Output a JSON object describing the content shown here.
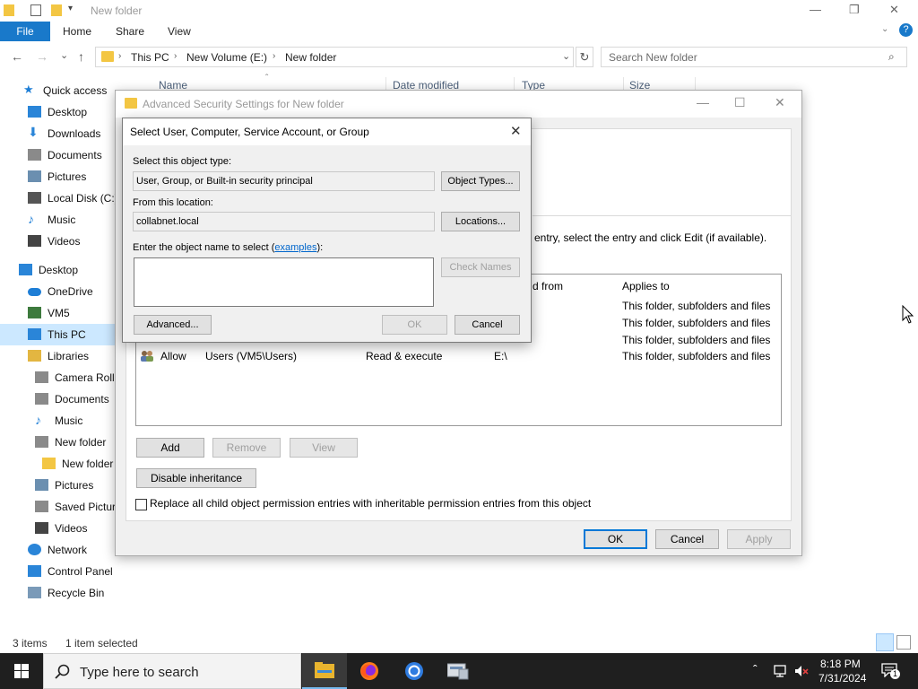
{
  "explorer": {
    "window_title": "New folder",
    "window_controls": {
      "minimize": "—",
      "maximize": "❐",
      "close": "✕"
    },
    "ribbon": {
      "file": "File",
      "home": "Home",
      "share": "Share",
      "view": "View",
      "expand": "⌄",
      "help": "?"
    },
    "nav_buttons": {
      "back": "←",
      "forward": "→",
      "recent": "⌄",
      "up": "↑"
    },
    "address": {
      "crumbs": [
        "This PC",
        "New Volume (E:)",
        "New folder"
      ],
      "sep": "›",
      "dropdown": "⌄",
      "refresh": "↻"
    },
    "search": {
      "placeholder": "Search New folder",
      "icon": "⌕"
    },
    "columns": [
      "Name",
      "Date modified",
      "Type",
      "Size"
    ],
    "sort_glyph": "ˆ",
    "sidebar": [
      {
        "label": "Quick access",
        "icon": "star-icon",
        "color": "#1e7ed6"
      },
      {
        "label": "Desktop",
        "icon": "desktop-icon",
        "color": "#2a85d8"
      },
      {
        "label": "Downloads",
        "icon": "downloads-icon",
        "color": "#2a85d8"
      },
      {
        "label": "Documents",
        "icon": "documents-icon",
        "color": "#8a8a8a"
      },
      {
        "label": "Pictures",
        "icon": "pictures-icon",
        "color": "#6b8fb0"
      },
      {
        "label": "Local Disk (C:)",
        "icon": "disk-icon",
        "color": "#555555"
      },
      {
        "label": "Music",
        "icon": "music-icon",
        "color": "#1e7ed6"
      },
      {
        "label": "Videos",
        "icon": "videos-icon",
        "color": "#444444"
      },
      {
        "label": "Desktop",
        "icon": "desktop-icon",
        "color": "#2a85d8"
      },
      {
        "label": "OneDrive",
        "icon": "onedrive-icon",
        "color": "#1e7ed6"
      },
      {
        "label": "VM5",
        "icon": "user-icon",
        "color": "#3d7a3d"
      },
      {
        "label": "This PC",
        "icon": "pc-icon",
        "color": "#2a85d8"
      },
      {
        "label": "Libraries",
        "icon": "libraries-icon",
        "color": "#e3b641"
      },
      {
        "label": "Camera Roll",
        "icon": "library-folder-icon",
        "color": "#8a8a8a"
      },
      {
        "label": "Documents",
        "icon": "documents-icon",
        "color": "#8a8a8a"
      },
      {
        "label": "Music",
        "icon": "music-icon",
        "color": "#1e7ed6"
      },
      {
        "label": "New folder",
        "icon": "library-folder-icon",
        "color": "#8a8a8a"
      },
      {
        "label": "New folder",
        "icon": "folder-icon",
        "color": "#f3c643"
      },
      {
        "label": "Pictures",
        "icon": "pictures-icon",
        "color": "#6b8fb0"
      },
      {
        "label": "Saved Pictures",
        "icon": "pictures-icon",
        "color": "#8a8a8a"
      },
      {
        "label": "Videos",
        "icon": "videos-icon",
        "color": "#444444"
      },
      {
        "label": "Network",
        "icon": "network-icon",
        "color": "#2a85d8"
      },
      {
        "label": "Control Panel",
        "icon": "control-panel-icon",
        "color": "#2a85d8"
      },
      {
        "label": "Recycle Bin",
        "icon": "recycle-bin-icon",
        "color": "#7a9ab8"
      }
    ],
    "status": {
      "items": "3 items",
      "selected": "1 item selected"
    }
  },
  "advanced_dialog": {
    "title": "Advanced Security Settings for New folder",
    "controls": {
      "minimize": "—",
      "maximize": "☐",
      "close": "✕"
    },
    "instruction": "entry, select the entry and click Edit (if available).",
    "columns": {
      "inherited_from": "d from",
      "applies_to": "Applies to"
    },
    "applies_rows": [
      "This folder, subfolders and files",
      "This folder, subfolders and files",
      "This folder, subfolders and files"
    ],
    "entry": {
      "type": "Allow",
      "principal": "Users (VM5\\Users)",
      "access": "Read & execute",
      "inherited_from": "E:\\",
      "applies_to": "This folder, subfolders and files"
    },
    "buttons": {
      "add": "Add",
      "remove": "Remove",
      "view": "View",
      "disable_inheritance": "Disable inheritance",
      "ok": "OK",
      "cancel": "Cancel",
      "apply": "Apply"
    },
    "replace_label": "Replace all child object permission entries with inheritable permission entries from this object"
  },
  "select_dialog": {
    "title": "Select User, Computer, Service Account, or Group",
    "close": "✕",
    "object_type_label": "Select this object type:",
    "object_type_value": "User, Group, or Built-in security principal",
    "object_types_button": "Object Types...",
    "location_label": "From this location:",
    "location_value": "collabnet.local",
    "locations_button": "Locations...",
    "enter_label_prefix": "Enter the object name to select (",
    "examples_link": "examples",
    "enter_label_suffix": "):",
    "check_names_button": "Check Names",
    "advanced_button": "Advanced...",
    "ok_button": "OK",
    "cancel_button": "Cancel"
  },
  "taskbar": {
    "search_placeholder": "Type here to search",
    "time": "8:18 PM",
    "date": "7/31/2024",
    "notification_count": "1",
    "tray_up": "ˆ"
  }
}
